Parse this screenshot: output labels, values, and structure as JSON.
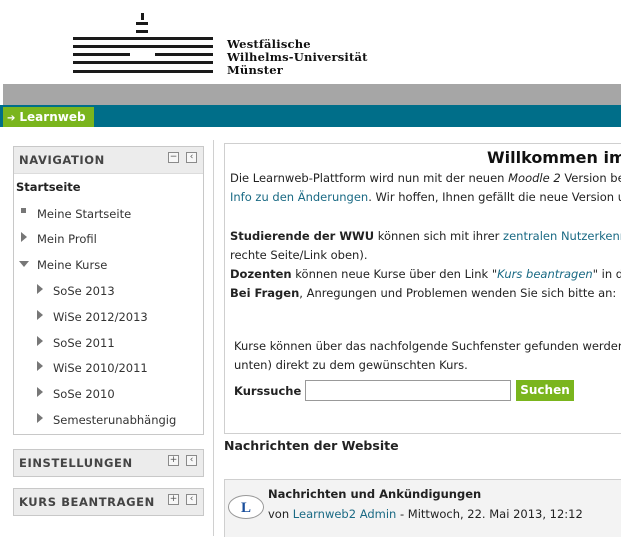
{
  "header": {
    "university_line1": "Westfälische",
    "university_line2": "Wilhelms-Universität",
    "university_line3": "Münster"
  },
  "tabs": {
    "learnweb_label": "Learnweb"
  },
  "sidebar": {
    "navigation": {
      "title": "NAVIGATION",
      "home": "Startseite",
      "items": [
        {
          "label": "Meine Startseite"
        },
        {
          "label": "Mein Profil"
        },
        {
          "label": "Meine Kurse"
        }
      ],
      "courses": [
        {
          "label": "SoSe 2013"
        },
        {
          "label": "WiSe 2012/2013"
        },
        {
          "label": "SoSe 2011"
        },
        {
          "label": "WiSe 2010/2011"
        },
        {
          "label": "SoSe 2010"
        },
        {
          "label": "Semesterunabhängig"
        }
      ]
    },
    "einstellungen_title": "EINSTELLUNGEN",
    "kurs_beantragen_title": "KURS BEANTRAGEN"
  },
  "main": {
    "welcome_title": "Willkommen im",
    "intro_line1_a": "Die Learnweb-Plattform wird nun mit der neuen ",
    "intro_line1_b": "Moodle 2",
    "intro_line1_c": " Version be",
    "intro_line2_link": "Info zu den Änderungen",
    "intro_line2_rest": ". Wir hoffen, Ihnen gefällt die neue Version u",
    "studierende_bold": "Studierende der WWU",
    "studierende_rest": " können sich mit ihrer ",
    "studierende_link": "zentralen Nutzerkenn",
    "studierende_line2": "rechte Seite/Link oben).",
    "dozenten_bold": "Dozenten",
    "dozenten_rest_a": " können neue Kurse über den Link \"",
    "dozenten_link": "Kurs beantragen",
    "dozenten_rest_b": "\" in d",
    "fragen_bold": "Bei Fragen",
    "fragen_rest": ", Anregungen und Problemen wenden Sie sich bitte an: l",
    "search_info_line1": "Kurse können über das nachfolgende Suchfenster gefunden werden",
    "search_info_line2": "unten) direkt zu dem gewünschten Kurs.",
    "kurssuche_label": "Kurssuche",
    "kurssuche_value": "",
    "suchen_button": "Suchen"
  },
  "news": {
    "section_title": "Nachrichten der Website",
    "forum_title": "Nachrichten und Ankündigungen",
    "by_prefix": "von ",
    "author": "Learnweb2 Admin",
    "date": " - Mittwoch, 22. Mai 2013, 12:12"
  },
  "colors": {
    "accent_green": "#7ab51d",
    "nav_teal": "#006e89",
    "link": "#1a6a84"
  }
}
